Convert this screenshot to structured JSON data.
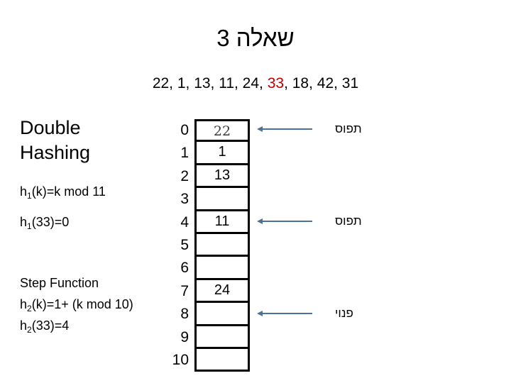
{
  "slide": {
    "title": "שאלה 3",
    "keys_line": {
      "prefix": "22, 1, 13, 11, 24, ",
      "highlight": "33",
      "suffix": ", 18, 42, 31",
      "highlight_color": "#C00000"
    },
    "left": {
      "heading_line1": "Double",
      "heading_line2": "Hashing",
      "h1_definition": "(k)=k mod 11",
      "h1_definition_base": "h",
      "h1_definition_sub": "1",
      "h1_value": "(33)=0",
      "h1_value_base": "h",
      "h1_value_sub": "1",
      "step_function_title": "Step Function",
      "h2_definition_base": "h",
      "h2_definition_sub": "2",
      "h2_definition": "(k)=1+ (k mod 10)",
      "h2_value_base": "h",
      "h2_value_sub": "2",
      "h2_value": "(33)=4"
    },
    "table": {
      "rows": [
        {
          "index": "0",
          "value": "22"
        },
        {
          "index": "1",
          "value": "1"
        },
        {
          "index": "2",
          "value": "13"
        },
        {
          "index": "3",
          "value": ""
        },
        {
          "index": "4",
          "value": "11"
        },
        {
          "index": "5",
          "value": ""
        },
        {
          "index": "6",
          "value": ""
        },
        {
          "index": "7",
          "value": "24"
        },
        {
          "index": "8",
          "value": ""
        },
        {
          "index": "9",
          "value": ""
        },
        {
          "index": "10",
          "value": ""
        }
      ]
    },
    "annotations": [
      {
        "label": "תפוס",
        "target_index": "0",
        "color": "#4A7296"
      },
      {
        "label": "תפוס",
        "target_index": "4",
        "color": "#4A7296"
      },
      {
        "label": "פנוי",
        "target_index": "8",
        "color": "#4A7296"
      }
    ]
  }
}
